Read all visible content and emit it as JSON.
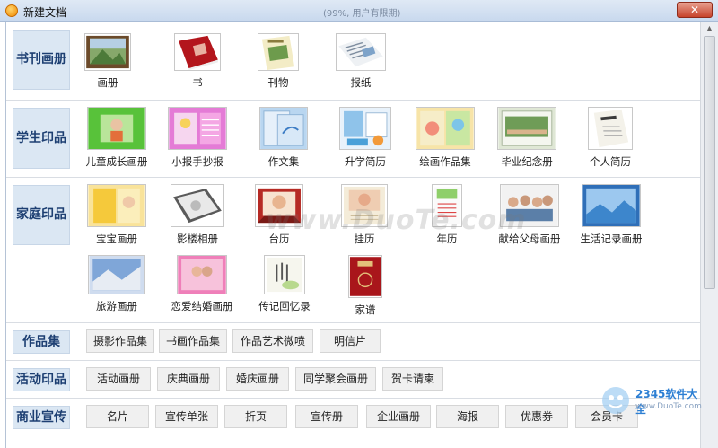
{
  "window": {
    "title": "新建文档",
    "subtitle": "(99%, 用户有限期)",
    "close_glyph": "✕"
  },
  "sections": [
    {
      "label": "书刊画册",
      "items": [
        {
          "label": "画册",
          "icon": "album-thumbnail"
        },
        {
          "label": "书",
          "icon": "book-thumbnail"
        },
        {
          "label": "刊物",
          "icon": "magazine-thumbnail"
        },
        {
          "label": "报纸",
          "icon": "newspaper-thumbnail"
        }
      ]
    },
    {
      "label": "学生印品",
      "items": [
        {
          "label": "儿童成长画册",
          "icon": "child-growth-album-thumbnail"
        },
        {
          "label": "小报手抄报",
          "icon": "handwritten-paper-thumbnail"
        },
        {
          "label": "作文集",
          "icon": "essay-collection-thumbnail"
        },
        {
          "label": "升学简历",
          "icon": "admission-resume-thumbnail"
        },
        {
          "label": "绘画作品集",
          "icon": "painting-portfolio-thumbnail"
        },
        {
          "label": "毕业纪念册",
          "icon": "graduation-album-thumbnail"
        },
        {
          "label": "个人简历",
          "icon": "personal-resume-thumbnail"
        }
      ]
    },
    {
      "label": "家庭印品",
      "items": [
        {
          "label": "宝宝画册",
          "icon": "baby-album-thumbnail"
        },
        {
          "label": "影楼相册",
          "icon": "studio-album-thumbnail"
        },
        {
          "label": "台历",
          "icon": "desk-calendar-thumbnail"
        },
        {
          "label": "挂历",
          "icon": "wall-calendar-thumbnail"
        },
        {
          "label": "年历",
          "icon": "annual-calendar-thumbnail"
        },
        {
          "label": "献给父母画册",
          "icon": "parents-album-thumbnail"
        },
        {
          "label": "生活记录画册",
          "icon": "life-record-album-thumbnail"
        },
        {
          "label": "旅游画册",
          "icon": "travel-album-thumbnail"
        },
        {
          "label": "恋爱结婚画册",
          "icon": "wedding-album-thumbnail"
        },
        {
          "label": "传记回忆录",
          "icon": "memoir-thumbnail"
        },
        {
          "label": "家谱",
          "icon": "family-tree-thumbnail"
        }
      ]
    },
    {
      "label": "作品集",
      "buttons": [
        "摄影作品集",
        "书画作品集",
        "作品艺术微喷",
        "明信片"
      ]
    },
    {
      "label": "活动印品",
      "buttons": [
        "活动画册",
        "庆典画册",
        "婚庆画册",
        "同学聚会画册",
        "贺卡请柬"
      ]
    },
    {
      "label": "商业宣传",
      "buttons": [
        "名片",
        "宣传单张",
        "折页",
        "宣传册",
        "企业画册",
        "海报",
        "优惠券",
        "会员卡"
      ]
    }
  ],
  "watermarks": {
    "site": "www.DuoTe.com",
    "brand": "2345软件大全",
    "url": "www.DuoTe.com"
  },
  "colors": {
    "category_bg": "#dbe7f3",
    "category_text": "#1d3f72",
    "button_bg": "#f0f0f0"
  }
}
